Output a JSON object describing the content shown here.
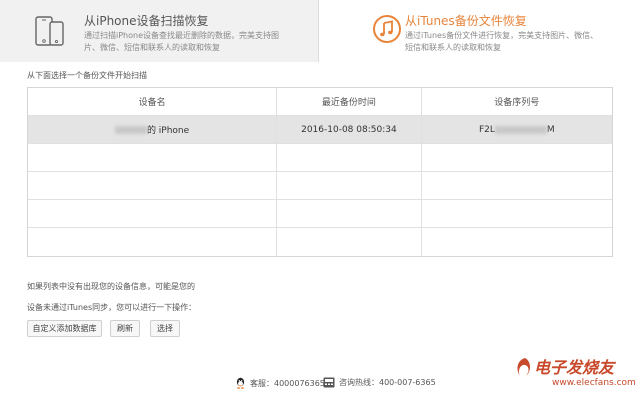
{
  "tabs": [
    {
      "title": "从iPhone设备扫描恢复",
      "description": "通过扫描iPhone设备查找最近删除的数据，完美支持图片、微信、短信和联系人的读取和恢复",
      "icon": "phone-icon",
      "active": false
    },
    {
      "title": "从iTunes备份文件恢复",
      "description": "通过iTunes备份文件进行恢复，完美支持图片、微信、短信和联系人的读取和恢复",
      "icon": "music-note-icon",
      "active": true
    }
  ],
  "hint": "从下面选择一个备份文件开始扫描",
  "table": {
    "headers": [
      "设备名",
      "最近备份时间",
      "设备序列号"
    ],
    "rows": [
      {
        "device_name": "的 iPhone",
        "backup_time": "2016-10-08  08:50:34",
        "serial_prefix": "F2L",
        "serial_suffix": "M"
      }
    ],
    "empty_rows": 4
  },
  "notes": {
    "line1": "如果列表中没有出现您的设备信息，可能是您的",
    "line2": "设备未通过iTunes同步，您可以进行一下操作："
  },
  "buttons": {
    "add": "自定义添加数据库",
    "refresh": "刷新",
    "select": "选择"
  },
  "footer": {
    "qq": "客服：4000076365",
    "phone": "咨询热线：400-007-6365"
  },
  "watermark": {
    "main": "电子发烧友",
    "sub": "www.elecfans.com"
  },
  "colors": {
    "accent": "#e8843a",
    "watermark": "#c84a2c",
    "selected_row": "#e4e4e4"
  }
}
